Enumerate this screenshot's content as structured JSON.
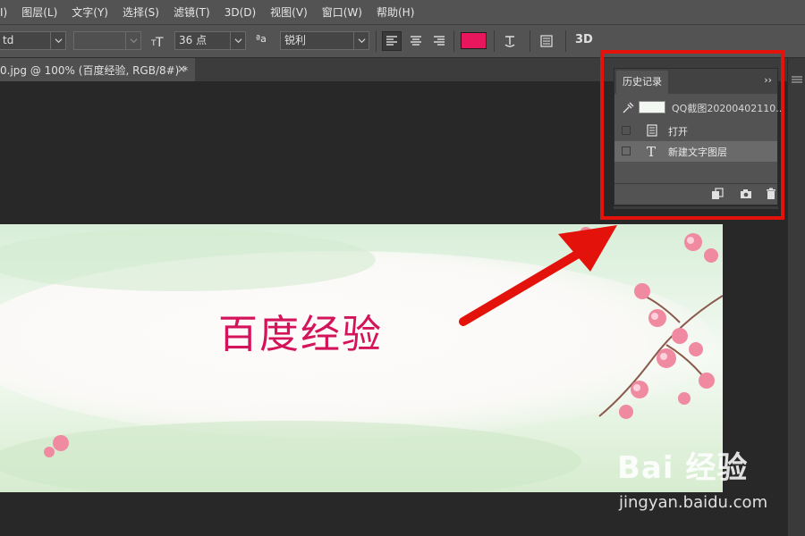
{
  "menubar": {
    "items": [
      "I)",
      "图层(L)",
      "文字(Y)",
      "选择(S)",
      "滤镜(T)",
      "3D(D)",
      "视图(V)",
      "窗口(W)",
      "帮助(H)"
    ]
  },
  "options": {
    "font_family": "td",
    "font_style": "",
    "font_size": "36 点",
    "antialias_icon_label": "ªa",
    "antialias": "锐利",
    "text_color": "#e8175d",
    "icons": [
      "text-orientation-icon",
      "align-left-icon",
      "align-center-icon",
      "align-right-icon",
      "warp-text-icon",
      "character-panel-icon",
      "3d-icon"
    ],
    "threeD_label": "3D"
  },
  "document_tab": {
    "title": "0.jpg @ 100% (百度经验, RGB/8#) *",
    "close": "×"
  },
  "canvas": {
    "text": "百度经验",
    "text_color": "#d4145a"
  },
  "history_panel": {
    "tab_label": "历史记录",
    "collapse": "››",
    "snapshot_label": "QQ截图20200402110...",
    "entries": [
      {
        "label": "打开",
        "icon": "document-icon",
        "selected": false
      },
      {
        "label": "新建文字图层",
        "icon": "type-icon",
        "selected": true
      }
    ],
    "footer_icons": [
      "new-document-from-state-icon",
      "camera-icon",
      "trash-icon"
    ]
  },
  "annotation": {
    "color": "#e3120b"
  },
  "watermark": {
    "text": "Bai 经验",
    "url": "jingyan.baidu.com"
  }
}
